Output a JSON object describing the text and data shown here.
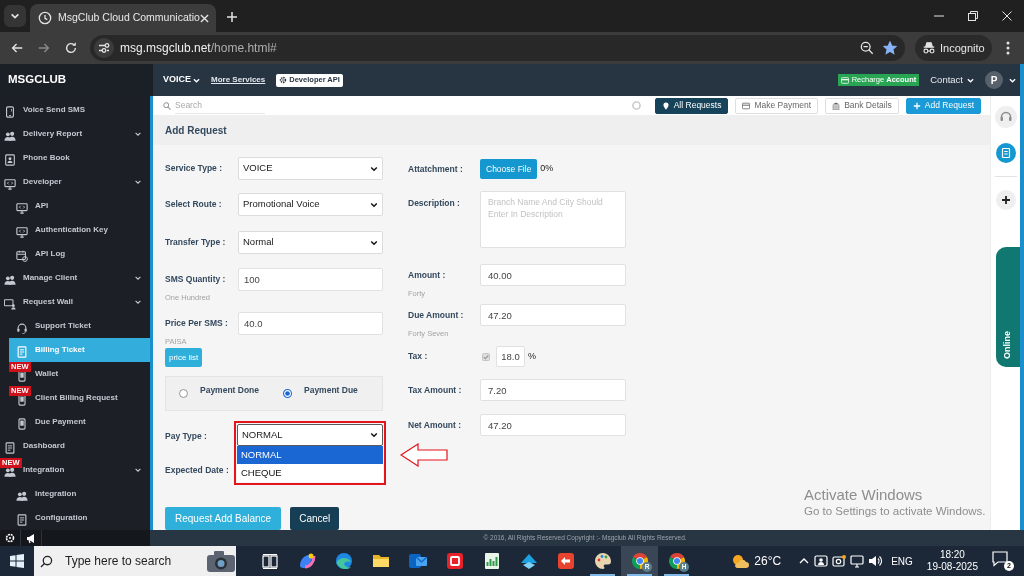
{
  "browser": {
    "tab_title": "MsgClub Cloud Communicatio",
    "url_host": "msg.msgclub.net",
    "url_path": "/home.html#",
    "bookmarked": true,
    "profile_label": "Incognito"
  },
  "header": {
    "logo": "MSGCLUB",
    "service_menu": "VOICE",
    "more_services": "More Services",
    "developer_api": "Developer API",
    "recharge": "Recharge **Account**",
    "contact": "Contact",
    "avatar_letter": "P"
  },
  "sidebar": {
    "items": [
      {
        "label": "Voice Send SMS",
        "selected": false,
        "collapsible": false
      },
      {
        "label": "Delivery Report",
        "selected": false,
        "collapsible": true
      },
      {
        "label": "Phone Book",
        "selected": false,
        "collapsible": false
      },
      {
        "label": "Developer",
        "selected": false,
        "collapsible": true,
        "children": [
          {
            "label": "API",
            "selected": false
          },
          {
            "label": "Authentication Key",
            "selected": false
          },
          {
            "label": "API Log",
            "selected": false
          }
        ]
      },
      {
        "label": "Manage Client",
        "selected": false,
        "collapsible": true
      },
      {
        "label": "Request Wall",
        "selected": false,
        "collapsible": true,
        "children": [
          {
            "label": "Support Ticket",
            "selected": false
          },
          {
            "label": "Billing Ticket",
            "selected": true
          },
          {
            "label": "Wallet",
            "selected": false,
            "badge": "NEW"
          },
          {
            "label": "Client Billing Request",
            "selected": false,
            "badge": "NEW"
          },
          {
            "label": "Due Payment",
            "selected": false
          }
        ]
      },
      {
        "label": "Dashboard",
        "selected": false,
        "collapsible": false
      },
      {
        "label": "Integration",
        "selected": false,
        "collapsible": true,
        "badge": "NEW",
        "children": [
          {
            "label": "Integration",
            "selected": false
          },
          {
            "label": "Configuration",
            "selected": false
          }
        ]
      }
    ]
  },
  "toolbar": {
    "search_placeholder": "Search",
    "buttons": [
      {
        "label": "All Requests",
        "kind": "dark"
      },
      {
        "label": "Make Payment",
        "kind": "outline"
      },
      {
        "label": "Bank Details",
        "kind": "outline"
      },
      {
        "label": "Add Request",
        "kind": "primary"
      }
    ]
  },
  "form": {
    "title": "Add Request",
    "left_fields": [
      {
        "kind": "select",
        "label": "Service Type :",
        "value": "VOICE"
      },
      {
        "kind": "select",
        "label": "Select Route :",
        "value": "Promotional Voice"
      },
      {
        "kind": "select",
        "label": "Transfer Type :",
        "value": "Normal"
      },
      {
        "kind": "input",
        "label": "SMS Quantity :",
        "value": "100",
        "hint": "One Hundred"
      },
      {
        "kind": "input",
        "label": "Price Per SMS :",
        "value": "40.0",
        "hint": "PAISA"
      }
    ],
    "price_list": "price list",
    "payment_status": [
      {
        "label": "Payment Done",
        "selected": false
      },
      {
        "label": "Payment Due",
        "selected": true
      }
    ],
    "pay_type": {
      "label": "Pay Type :",
      "value": "NORMAL",
      "expanded": true,
      "annotated": true,
      "options": [
        {
          "label": "NORMAL",
          "selected": true
        },
        {
          "label": "CHEQUE",
          "selected": false
        }
      ]
    },
    "expected_date_label": "Expected Date :",
    "right_fields": [
      {
        "kind": "file",
        "label": "Attatchment :",
        "button": "Choose File",
        "progress": "0%"
      },
      {
        "kind": "textarea",
        "label": "Description :",
        "placeholder": "Branch Name And City Should Enter In Description"
      },
      {
        "kind": "input",
        "label": "Amount :",
        "value": "40.00",
        "hint": "Forty"
      },
      {
        "kind": "input",
        "label": "Due Amount :",
        "value": "47.20",
        "hint": "Forty Seven"
      },
      {
        "kind": "tax",
        "label": "Tax :",
        "checked": true,
        "disabled": true,
        "value": "18.0",
        "unit": "%"
      },
      {
        "kind": "input",
        "label": "Tax Amount :",
        "value": "7.20"
      },
      {
        "kind": "input",
        "label": "Net Amount :",
        "value": "47.20"
      }
    ],
    "buttons": [
      {
        "label": "Request Add Balance",
        "kind": "primary"
      },
      {
        "label": "Cancel",
        "kind": "dark"
      }
    ]
  },
  "right_rail": {
    "online_label": "Online"
  },
  "footer": {
    "copyright": "© 2016, All Rights Reserved Copyright :- Msgclub All Rights Reserved."
  },
  "system_overlay": {
    "title": "Activate Windows",
    "subtitle": "Go to Settings to activate Windows."
  },
  "taskbar": {
    "search_placeholder": "Type here to search",
    "apps": [
      {
        "running": false,
        "selected": false
      },
      {
        "running": false,
        "selected": false
      },
      {
        "running": false,
        "selected": false
      },
      {
        "running": false,
        "selected": false
      },
      {
        "running": false,
        "selected": false
      },
      {
        "running": false,
        "selected": false
      },
      {
        "running": false,
        "selected": false
      },
      {
        "running": false,
        "selected": false
      },
      {
        "running": true,
        "selected": false
      },
      {
        "running": true,
        "selected": true,
        "badge": "R"
      },
      {
        "running": true,
        "selected": false,
        "badge": "H"
      }
    ],
    "weather": "26°C",
    "language": "ENG",
    "time": "18:20",
    "date": "19-08-2025",
    "notifications": "2"
  }
}
